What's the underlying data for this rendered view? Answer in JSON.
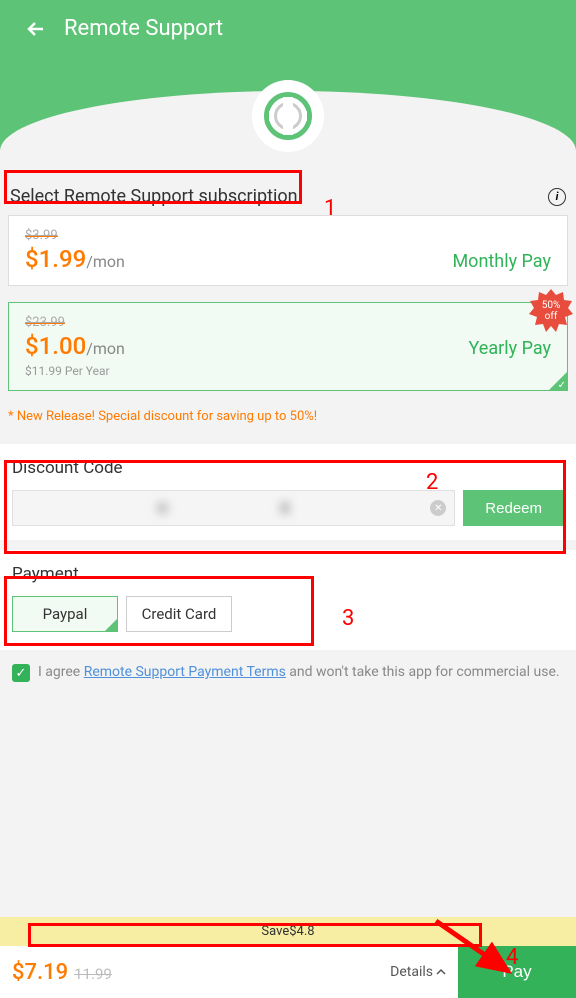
{
  "header": {
    "title": "Remote Support"
  },
  "subscription": {
    "title": "Select Remote Support subscription",
    "monthly": {
      "original": "$3.99",
      "price": "$1.99",
      "per": "/mon",
      "label": "Monthly Pay"
    },
    "yearly": {
      "original": "$23.99",
      "price": "$1.00",
      "per": "/mon",
      "label": "Yearly Pay",
      "year_note": "$11.99 Per Year",
      "badge_line1": "50%",
      "badge_line2": "off"
    },
    "release_note": "* New Release! Special discount for saving up to 50%!"
  },
  "discount": {
    "label": "Discount Code",
    "value": "K                           8",
    "redeem": "Redeem"
  },
  "payment": {
    "label": "Payment",
    "paypal": "Paypal",
    "credit": "Credit Card"
  },
  "agreement": {
    "prefix": "I agree ",
    "link": "Remote Support Payment Terms",
    "suffix": " and won't take this app for commercial use."
  },
  "bottom": {
    "save": "Save$4.8",
    "current": "$7.19",
    "original": "11.99",
    "details": "Details",
    "pay": "Pay"
  },
  "annotations": {
    "n1": "1",
    "n2": "2",
    "n3": "3",
    "n4": "4"
  }
}
